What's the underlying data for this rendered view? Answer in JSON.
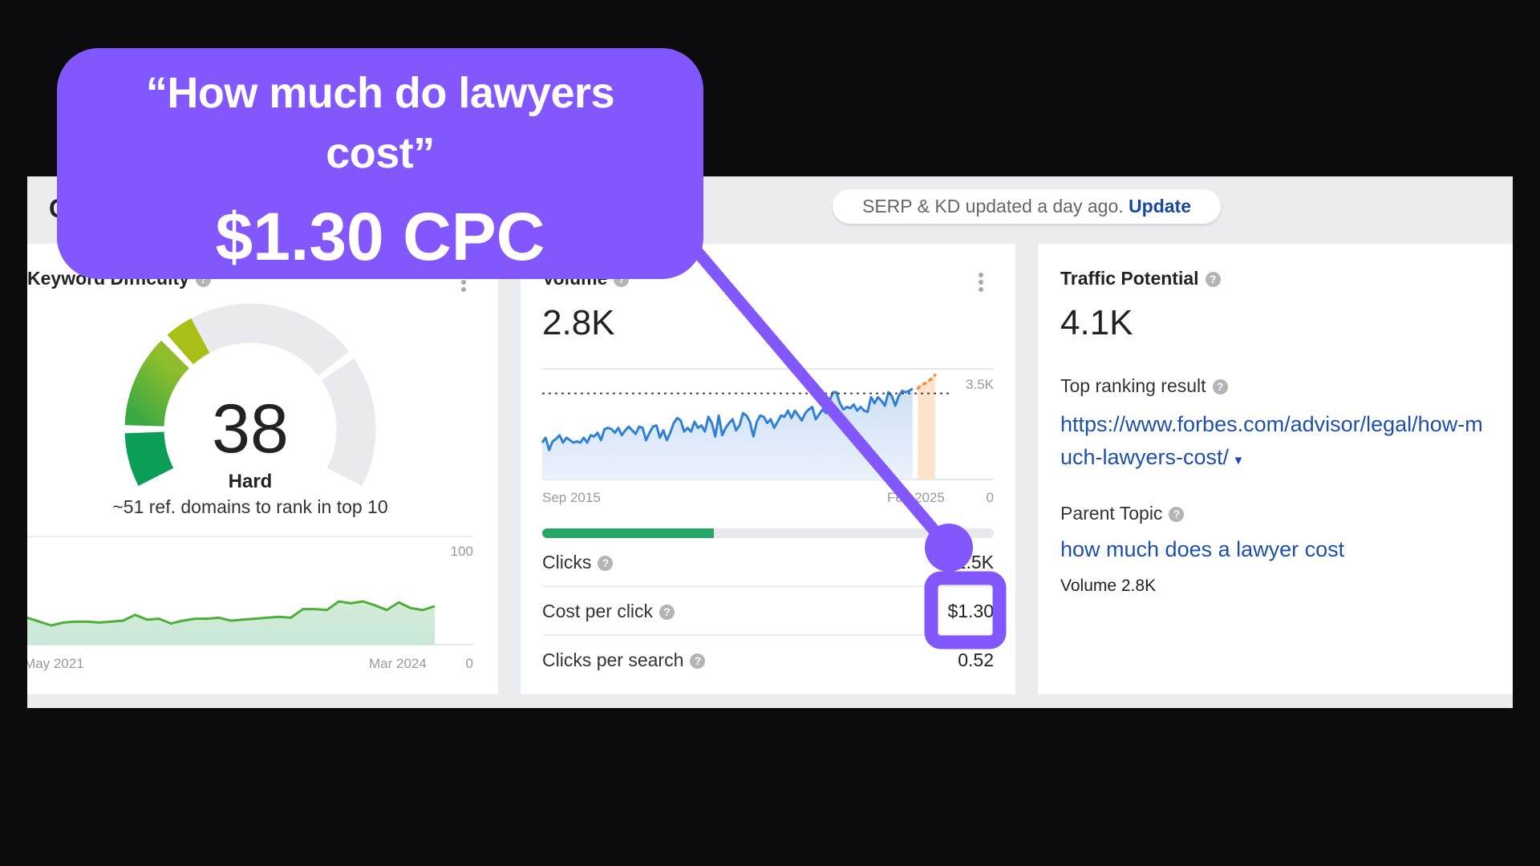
{
  "callout": {
    "line1": "“How much do lawyers",
    "line2": "cost”",
    "headline": "$1.30 CPC",
    "color": "#8257fe"
  },
  "header": {
    "partial_title": "C",
    "serp_status": "SERP & KD updated a day ago.",
    "update_link": "Update"
  },
  "keyword_difficulty": {
    "title": "Keyword Difficulty",
    "score": "38",
    "score_value": 38,
    "label": "Hard",
    "description": "~51 ref. domains to rank in top 10",
    "help_icon": "question-circle-icon",
    "menu_icon": "kebab-menu-icon"
  },
  "volume": {
    "title": "Volume",
    "value": "2.8K",
    "clicks_share_percent": 38,
    "metrics": [
      {
        "label": "Clicks",
        "value": "1.5K"
      },
      {
        "label": "Cost per click",
        "value": "$1.30"
      },
      {
        "label": "Clicks per search",
        "value": "0.52"
      }
    ]
  },
  "traffic_potential": {
    "title": "Traffic Potential",
    "value": "4.1K",
    "top_ranking_label": "Top ranking result",
    "top_ranking_url_line1": "https://www.forbes.com/advisor/legal/how-m",
    "top_ranking_url_line2": "uch-lawyers-cost/",
    "parent_topic_label": "Parent Topic",
    "parent_topic_link": "how much does a lawyer cost",
    "parent_topic_volume": "Volume 2.8K"
  },
  "chart_data": [
    {
      "type": "area",
      "title": "",
      "x_start_label": "May 2021",
      "x_end_label": "Mar 2024",
      "y_max_label": "100",
      "y_min_label": "0",
      "ylim": [
        0,
        100
      ],
      "values": [
        28,
        24,
        20,
        23,
        24,
        24,
        23,
        24,
        25,
        31,
        26,
        27,
        22,
        25,
        27,
        27,
        28,
        25,
        26,
        27,
        28,
        29,
        28,
        37,
        37,
        36,
        45,
        43,
        45,
        41,
        36,
        44,
        38,
        36,
        40
      ],
      "color": "#4caf3a"
    },
    {
      "type": "area",
      "title": "",
      "x_start_label": "Sep 2015",
      "x_end_label": "Feb 2025",
      "y_max_label": "3.5K",
      "y_min_label": "0",
      "ylim": [
        0,
        4500
      ],
      "reference_line": 3500,
      "values": [
        1500,
        1700,
        1200,
        1550,
        1650,
        1800,
        1500,
        1700,
        1600,
        1500,
        1550,
        1500,
        1700,
        1500,
        1800,
        1750,
        1900,
        1600,
        2050,
        2100,
        2050,
        1900,
        2100,
        1800,
        2000,
        2150,
        2000,
        1850,
        2150,
        2100,
        1600,
        1900,
        2150,
        2200,
        1700,
        2000,
        1600,
        1900,
        2300,
        2500,
        2400,
        1950,
        2100,
        1950,
        2350,
        2100,
        2200,
        1950,
        2550,
        2300,
        1750,
        2600,
        1800,
        2100,
        2300,
        2450,
        2000,
        2200,
        2700,
        2600,
        2350,
        1750,
        2350,
        2600,
        2550,
        2300,
        2450,
        2100,
        2350,
        2600,
        2550,
        2800,
        2500,
        2800,
        2600,
        2400,
        2700,
        2850,
        2950,
        2450,
        2650,
        2850,
        2700,
        3200,
        3550,
        3550,
        3100,
        2850,
        2950,
        2900,
        3050,
        2800,
        2950,
        2800,
        2750,
        3350,
        3100,
        3350,
        3200,
        3000,
        3550,
        3400,
        3000,
        3400,
        3600,
        3550,
        3600,
        3700
      ],
      "forecast_values": [
        3700,
        3850,
        3900,
        4000,
        4100,
        4250
      ],
      "color": "#2f80d8",
      "forecast_color": "#f5913c"
    }
  ]
}
